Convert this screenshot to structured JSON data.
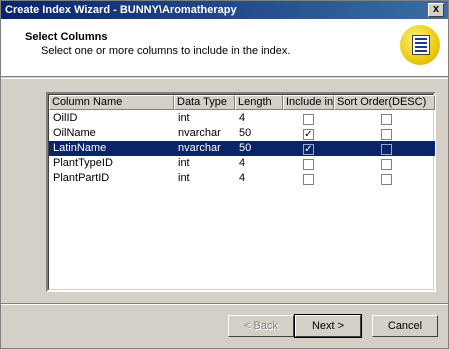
{
  "window": {
    "title": "Create Index Wizard - BUNNY\\Aromatherapy",
    "close_label": "x"
  },
  "header": {
    "title": "Select Columns",
    "subtitle": "Select one or more columns to include in the index."
  },
  "grid": {
    "headers": [
      "Column Name",
      "Data Type",
      "Length",
      "Include in...",
      "Sort Order(DESC)"
    ],
    "rows": [
      {
        "name": "OilID",
        "type": "int",
        "length": "4",
        "include": false,
        "desc": false,
        "selected": false
      },
      {
        "name": "OilName",
        "type": "nvarchar",
        "length": "50",
        "include": true,
        "desc": false,
        "selected": false
      },
      {
        "name": "LatinName",
        "type": "nvarchar",
        "length": "50",
        "include": true,
        "desc": false,
        "selected": true
      },
      {
        "name": "PlantTypeID",
        "type": "int",
        "length": "4",
        "include": false,
        "desc": false,
        "selected": false
      },
      {
        "name": "PlantPartID",
        "type": "int",
        "length": "4",
        "include": false,
        "desc": false,
        "selected": false
      }
    ]
  },
  "buttons": {
    "back": "< Back",
    "next": "Next >",
    "cancel": "Cancel"
  },
  "colors": {
    "title_bar_start": "#0a246a",
    "title_bar_end": "#3a6ea5",
    "selection": "#0a246a",
    "face": "#d4d0c8"
  }
}
